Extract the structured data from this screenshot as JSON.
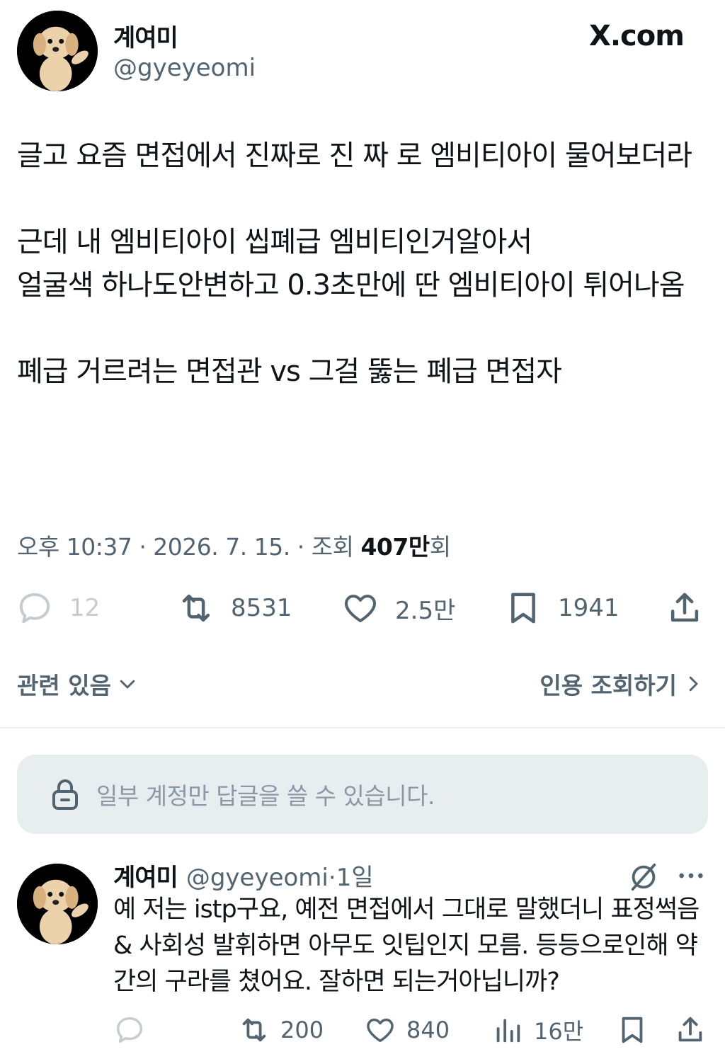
{
  "header": {
    "display_name": "계여미",
    "handle": "@gyeyeomi",
    "site_label": "X.com"
  },
  "tweet": {
    "paragraphs": [
      "글고 요즘 면접에서 진짜로 진 짜 로 엠비티아이 물어보더라",
      "근데 내 엠비티아이 씹폐급 엠비티인거알아서",
      "얼굴색 하나도안변하고 0.3초만에 딴 엠비티아이 튀어나옴",
      "폐급 거르려는 면접관 vs 그걸 뚫는 폐급 면접자"
    ],
    "time": "오후 10:37",
    "date": "2026. 7. 15.",
    "views_label": "조회",
    "views_count": "407만",
    "views_suffix": "회"
  },
  "actions": {
    "replies": "12",
    "retweets": "8531",
    "likes": "2.5만",
    "bookmarks": "1941"
  },
  "links": {
    "related": "관련 있음",
    "quotes": "인용 조회하기"
  },
  "restriction": {
    "text": "일부 계정만 답글을 쓸 수 있습니다."
  },
  "reply": {
    "display_name": "계여미",
    "handle": "@gyeyeomi",
    "separator": "·",
    "time": "1일",
    "text": "예 저는 istp구요, 예전 면접에서 그대로 말했더니 표정썩음 & 사회성 발휘하면 아무도 잇팁인지 모름. 등등으로인해 약간의 구라를 쳤어요. 잘하면 되는거아닙니까?",
    "retweets": "200",
    "likes": "840",
    "views": "16만"
  },
  "icons": {
    "reply": "reply-icon",
    "retweet": "retweet-icon",
    "like": "heart-icon",
    "bookmark": "bookmark-icon",
    "share": "share-icon",
    "views": "views-icon",
    "lock": "lock-icon",
    "grok": "grok-icon",
    "more": "more-icon"
  },
  "colors": {
    "text": "#0f1419",
    "secondary": "#536471",
    "muted_icon": "#c4ccd2",
    "restriction_bg": "#e8edf0",
    "avatar_bg": "#000000",
    "dog": "#e8c9a0"
  }
}
